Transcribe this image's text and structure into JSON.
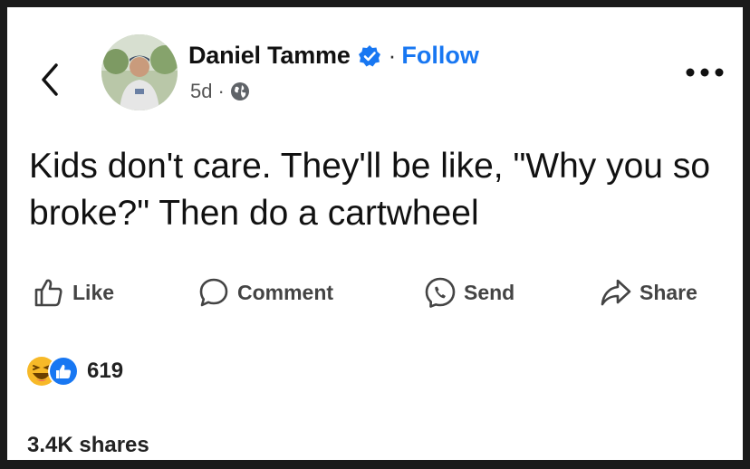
{
  "nav": {
    "back_icon": "chevron-left-icon"
  },
  "author": {
    "name": "Daniel Tamme",
    "verified_icon": "verified-badge-icon",
    "separator": "·",
    "follow_label": "Follow",
    "time": "5d",
    "time_separator": "·",
    "audience_icon": "globe-icon"
  },
  "menu": {
    "more_icon": "more-dots-icon"
  },
  "post": {
    "text": "Kids don't care. They'll be like, \"Why you so broke?\" Then do a cartwheel"
  },
  "actions": [
    {
      "label": "Like",
      "icon": "thumbs-up-icon"
    },
    {
      "label": "Comment",
      "icon": "comment-bubble-icon"
    },
    {
      "label": "Send",
      "icon": "messenger-icon"
    },
    {
      "label": "Share",
      "icon": "share-arrow-icon"
    }
  ],
  "reactions": {
    "icons": [
      "haha-emoji-icon",
      "like-reaction-icon"
    ],
    "count": "619"
  },
  "shares": "3.4K shares",
  "colors": {
    "accent": "#1877f2",
    "text": "#111111",
    "muted": "#555555"
  }
}
